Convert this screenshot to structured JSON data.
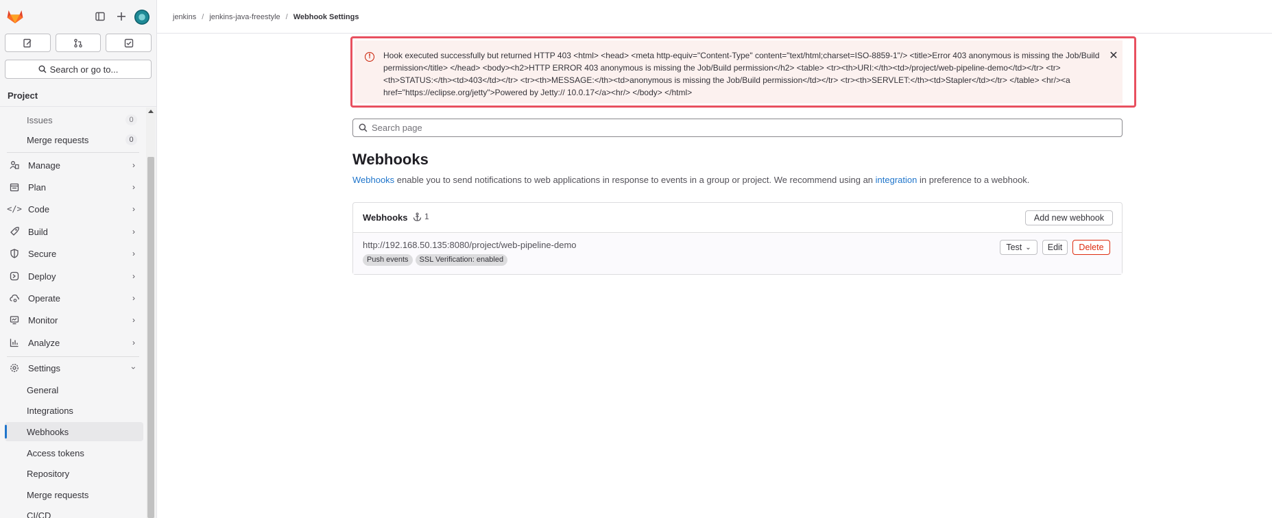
{
  "sidebar": {
    "search_label": "Search or go to...",
    "section_title": "Project",
    "items": [
      {
        "label": "Issues",
        "count": "0",
        "icon": "issues-icon"
      },
      {
        "label": "Merge requests",
        "count": "0",
        "icon": "merge-request-icon"
      },
      {
        "label": "Manage",
        "icon": "users-icon"
      },
      {
        "label": "Plan",
        "icon": "planning-icon"
      },
      {
        "label": "Code",
        "icon": "code-icon"
      },
      {
        "label": "Build",
        "icon": "rocket-icon"
      },
      {
        "label": "Secure",
        "icon": "shield-icon"
      },
      {
        "label": "Deploy",
        "icon": "deployments-icon"
      },
      {
        "label": "Operate",
        "icon": "cloud-gear-icon"
      },
      {
        "label": "Monitor",
        "icon": "monitor-icon"
      },
      {
        "label": "Analyze",
        "icon": "chart-icon"
      },
      {
        "label": "Settings",
        "icon": "settings-icon"
      }
    ],
    "settings_sub": [
      "General",
      "Integrations",
      "Webhooks",
      "Access tokens",
      "Repository",
      "Merge requests",
      "CI/CD"
    ]
  },
  "breadcrumb": [
    "jenkins",
    "jenkins-java-freestyle",
    "Webhook Settings"
  ],
  "alert": {
    "message": "Hook executed successfully but returned HTTP 403 <html> <head> <meta http-equiv=\"Content-Type\" content=\"text/html;charset=ISO-8859-1\"/> <title>Error 403 anonymous is missing the Job/Build permission</title> </head> <body><h2>HTTP ERROR 403 anonymous is missing the Job/Build permission</h2> <table> <tr><th>URI:</th><td>/project/web-pipeline-demo</td></tr> <tr><th>STATUS:</th><td>403</td></tr> <tr><th>MESSAGE:</th><td>anonymous is missing the Job/Build permission</td></tr> <tr><th>SERVLET:</th><td>Stapler</td></tr> </table> <hr/><a href=\"https://eclipse.org/jetty\">Powered by Jetty:// 10.0.17</a><hr/> </body> </html>"
  },
  "search_page": {
    "placeholder": "Search page"
  },
  "main": {
    "title": "Webhooks",
    "desc_link1": "Webhooks",
    "desc_mid": " enable you to send notifications to web applications in response to events in a group or project. We recommend using an ",
    "desc_link2": "integration",
    "desc_end": " in preference to a webhook."
  },
  "card": {
    "title": "Webhooks",
    "count": "1",
    "add_button": "Add new webhook",
    "hook": {
      "url": "http://192.168.50.135:8080/project/web-pipeline-demo",
      "badges": [
        "Push events",
        "SSL Verification: enabled"
      ],
      "test_label": "Test",
      "edit_label": "Edit",
      "delete_label": "Delete"
    }
  },
  "colors": {
    "accent": "#1f75cb",
    "danger": "#dd2b0e",
    "alert_border": "#e8505f",
    "alert_bg": "#fcf1ef"
  }
}
